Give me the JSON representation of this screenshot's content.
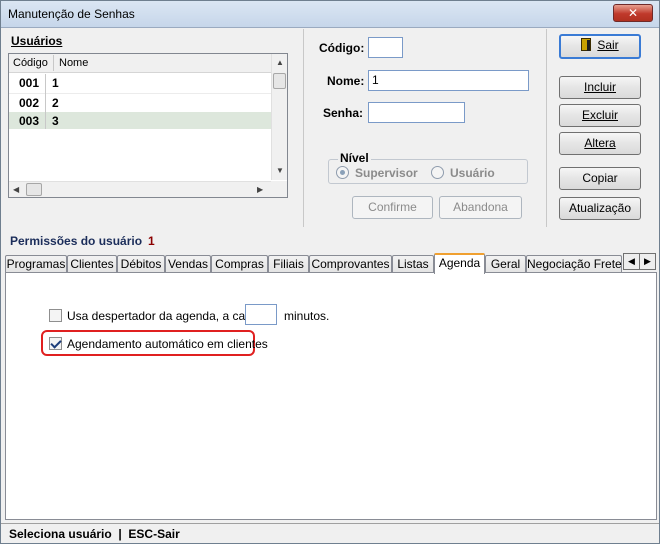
{
  "window": {
    "title": "Manutenção de Senhas",
    "close_glyph": "✕"
  },
  "users": {
    "label": "Usuários",
    "columns": [
      "Código",
      "Nome"
    ],
    "rows": [
      {
        "codigo": "001",
        "nome": "1"
      },
      {
        "codigo": "002",
        "nome": "2"
      },
      {
        "codigo": "003",
        "nome": "3"
      }
    ],
    "selected_index": 2
  },
  "form": {
    "codigo_label": "Código:",
    "codigo_value": "",
    "nome_label": "Nome:",
    "nome_value": "1",
    "senha_label": "Senha:",
    "senha_value": ""
  },
  "nivel": {
    "legend": "Nível",
    "options": [
      {
        "label": "Supervisor",
        "selected": true
      },
      {
        "label": "Usuário",
        "selected": false
      }
    ]
  },
  "buttons": {
    "sair": "Sair",
    "incluir": "Incluir",
    "excluir": "Excluir",
    "altera": "Altera",
    "copiar": "Copiar",
    "atualizacao": "Atualização",
    "confirme": "Confirme",
    "abandona": "Abandona"
  },
  "permissions": {
    "label": "Permissões do usuário",
    "value": "1"
  },
  "tabs": {
    "items": [
      "Programas",
      "Clientes",
      "Débitos",
      "Vendas",
      "Compras",
      "Filiais",
      "Comprovantes",
      "Listas",
      "Agenda",
      "Geral",
      "Negociação Frete"
    ],
    "active": "Agenda",
    "scroll_left": "◀",
    "scroll_right": "▶"
  },
  "agenda": {
    "alarm_label": "Usa despertador da agenda, a cada",
    "alarm_checked": false,
    "alarm_minutes": "",
    "minutes_suffix": "minutos.",
    "auto_schedule_label": "Agendamento automático em clientes",
    "auto_schedule_checked": true
  },
  "status": {
    "text": "Seleciona usuário  |  ESC-Sair"
  },
  "colors": {
    "highlight": "#e02020",
    "permission_value": "#8b0000",
    "active_tab": "#f0a030"
  }
}
